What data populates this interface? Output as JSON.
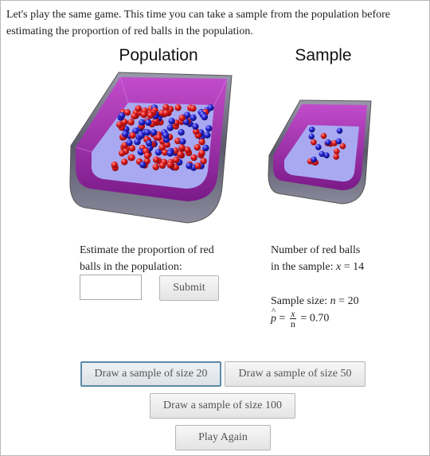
{
  "intro": "Let's play the same game. This time you can take a sample from the population before estimating the proportion of red balls in the population.",
  "population": {
    "heading": "Population"
  },
  "sample": {
    "heading": "Sample"
  },
  "estimate": {
    "label_line1": "Estimate the proportion of red",
    "label_line2": "balls in the population:",
    "input_value": "",
    "submit_label": "Submit"
  },
  "stats": {
    "count_line1": "Number of red balls",
    "count_prefix": "in the sample:",
    "count_var": "x",
    "count_value": "14",
    "size_prefix": "Sample size:",
    "size_var": "n",
    "size_value": "20",
    "phat_symbol": "p",
    "phat_num": "x",
    "phat_den": "n",
    "phat_value": "0.70"
  },
  "buttons": {
    "draw20": "Draw a sample of size 20",
    "draw50": "Draw a sample of size 50",
    "draw100": "Draw a sample of size 100",
    "play_again": "Play Again"
  },
  "colors": {
    "red_ball": "#d42020",
    "blue_ball": "#2a2ad0",
    "box_floor": "#a9a9f2",
    "box_wall": "#9a2aa3",
    "box_outer": "#6e6e80"
  }
}
